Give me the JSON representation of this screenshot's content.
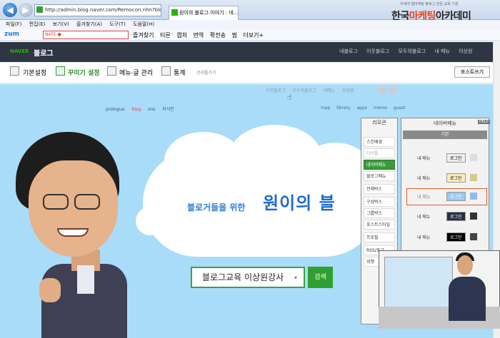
{
  "browser": {
    "address": "http://admin.blog.naver.com/Remocon.nhn?blogId=",
    "tab_title": "원이의 블로그:이야기 : 네...",
    "academy_tagline": "차세대 웹마케팅 블로그 전문 교육 기관",
    "academy_name_a": "한국",
    "academy_name_b": "마케팅",
    "academy_name_c": "아카데미",
    "menu": [
      "파일(F)",
      "편집(E)",
      "보기(V)",
      "즐겨찾기(A)",
      "도구(T)",
      "도움말(H)"
    ],
    "zum": "zum",
    "search_value": "NATE ●",
    "toolbar_items": [
      "즐겨찾기",
      "티몬",
      "캡처",
      "번역",
      "확전송",
      "찜",
      "더보기+"
    ]
  },
  "blog_header": {
    "naver": "NAVER",
    "title": "블로그",
    "nav": [
      "내블로그",
      "이웃블로그",
      "모두의블로그",
      "내 메뉴",
      "이상원"
    ]
  },
  "admin_bar": {
    "items": [
      "기본설정",
      "꾸미기 설정",
      "메뉴·글 관리",
      "통계",
      "관리툴가기"
    ],
    "post_button": "포스트쓰기"
  },
  "blog_body": {
    "top_row": [
      "이웃블로그",
      "모두의블로그",
      "내메뉴",
      "이상원"
    ],
    "menu_left": [
      "prologue",
      "blog",
      "sns",
      "지식인"
    ],
    "menu_right": [
      "map",
      "library",
      "apps",
      "memo",
      "guest"
    ],
    "headline_small": "블로거들을 위한",
    "headline_big": "원이의 블",
    "search_value": "블로그교육 이상원강사",
    "search_dropdown": "▾",
    "search_button": "검색"
  },
  "menu_panel": {
    "title": "리모콘",
    "items": [
      "스킨배경",
      "타이틀",
      "네이버메뉴",
      "블로그메뉴",
      "전체박스",
      "구성박스",
      "그룹박스",
      "포스트스타일",
      "프로필",
      "RSS/로고",
      "위젯"
    ]
  },
  "nav_panel": {
    "title": "네이버메뉴",
    "help": "HELP",
    "basic_tab": "기본",
    "rows": [
      {
        "label": "내 메뉴",
        "button": "로그인"
      },
      {
        "label": "내 메뉴",
        "button": "로그인"
      },
      {
        "label": "내 메뉴",
        "button": "로그인"
      },
      {
        "label": "내 메뉴",
        "button": "로그인"
      },
      {
        "label": "내 메뉴",
        "button": "로그인"
      }
    ]
  },
  "colors": {
    "naver_green": "#2db400",
    "header_dark": "#2e3543",
    "sky": "#a9dcf8",
    "highlight": "#e05a2a"
  }
}
